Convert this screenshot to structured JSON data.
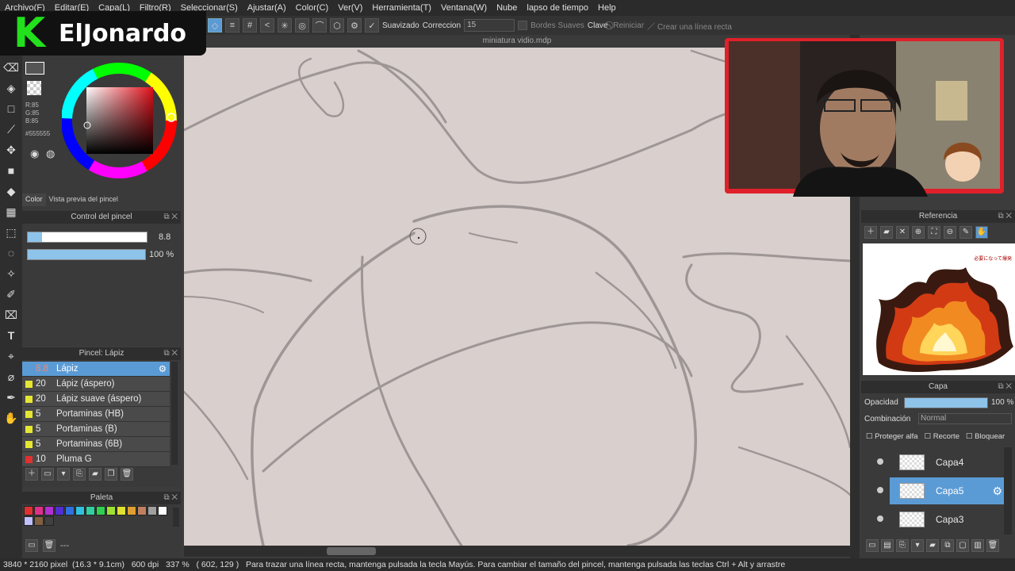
{
  "menu": [
    "Archivo(F)",
    "Editar(E)",
    "Capa(L)",
    "Filtro(R)",
    "Seleccionar(S)",
    "Ajustar(A)",
    "Color(C)",
    "Ver(V)",
    "Herramienta(T)",
    "Ventana(W)",
    "Nube",
    "lapso de tiempo",
    "Help"
  ],
  "toolbar": {
    "suavizado_label": "Suavizado",
    "correccion_label": "Correccion",
    "correccion_value": "15",
    "bordes_label": "Bordes Suaves",
    "clave_label": "Clave",
    "reiniciar_label": "Reiniciar",
    "linea_label": "Crear una línea recta"
  },
  "logo": {
    "letter": "K",
    "name": "ElJonardo"
  },
  "document_tab": "miniatura vidio.mdp",
  "color": {
    "r": "R:85",
    "g": "G:85",
    "b": "B:85",
    "hex": "#555555",
    "tab_color": "Color",
    "tab_preview": "Vista previa del pincel"
  },
  "brush_control": {
    "title": "Control del pincel",
    "size_value": "8.8",
    "opacity_value": "100 %",
    "size_fraction": 0.12,
    "opacity_fraction": 1.0
  },
  "brush_list": {
    "title": "Pincel: Lápiz",
    "items": [
      {
        "size": "8.8",
        "name": "Lápiz",
        "color": "#5b9bd5"
      },
      {
        "size": "20",
        "name": "Lápiz (áspero)",
        "color": "#e6e632"
      },
      {
        "size": "20",
        "name": "Lápiz suave (áspero)",
        "color": "#e6e632"
      },
      {
        "size": "5",
        "name": "Portaminas (HB)",
        "color": "#e6e632"
      },
      {
        "size": "5",
        "name": "Portaminas (B)",
        "color": "#e6e632"
      },
      {
        "size": "5",
        "name": "Portaminas (6B)",
        "color": "#e6e632"
      },
      {
        "size": "10",
        "name": "Pluma G",
        "color": "#e03030"
      }
    ]
  },
  "palette": {
    "title": "Paleta",
    "colors": [
      "#e03030",
      "#e0308a",
      "#b030d0",
      "#5030d0",
      "#3070e0",
      "#30c0e0",
      "#30d0a0",
      "#30d050",
      "#a0e030",
      "#e0e030",
      "#e0a030",
      "#c08060",
      "#a0a0a0",
      "#ffffff",
      "#c0c0ff",
      "#806040",
      "#404040"
    ],
    "footer": "---"
  },
  "reference": {
    "title": "Referencia",
    "image_caption": "必要になって爆発"
  },
  "layers": {
    "title": "Capa",
    "opacity_label": "Opacidad",
    "opacity_value": "100 %",
    "opacity_fraction": 1.0,
    "blend_label": "Combinación",
    "blend_value": "Normal",
    "protect_alpha": "Proteger alfa",
    "clip": "Recorte",
    "lock": "Bloquear",
    "items": [
      {
        "name": "Capa4",
        "selected": false
      },
      {
        "name": "Capa5",
        "selected": true
      },
      {
        "name": "Capa3",
        "selected": false
      }
    ]
  },
  "status": {
    "size": "3840 * 2160 pixel",
    "cm": "(16.3 * 9.1cm)",
    "dpi": "600 dpi",
    "zoom": "337 %",
    "coords": "( 602, 129 )",
    "hint": "Para trazar una línea recta, mantenga pulsada la tecla Mayús. Para cambiar el tamaño del pincel, mantenga pulsada las teclas Ctrl + Alt y arrastre"
  },
  "colors": {
    "accent": "#5b9bd5",
    "webcam_frame": "#e0202a",
    "canvas": "#d9cfcd"
  }
}
